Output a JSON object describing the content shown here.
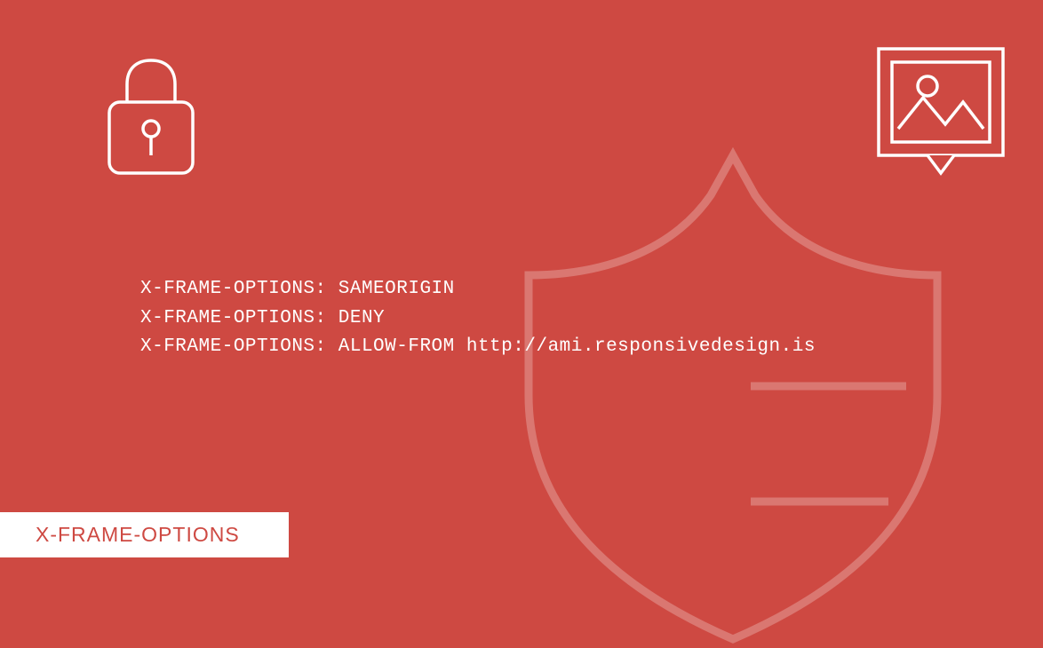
{
  "title": "X-FRAME-OPTIONS",
  "code": {
    "line1": "X-FRAME-OPTIONS: SAMEORIGIN",
    "line2": "X-FRAME-OPTIONS: DENY",
    "line3": "X-FRAME-OPTIONS: ALLOW-FROM http://ami.responsivedesign.is"
  },
  "colors": {
    "background": "#ce4942",
    "foreground": "#ffffff",
    "shield_overlay": "#e08a85"
  }
}
